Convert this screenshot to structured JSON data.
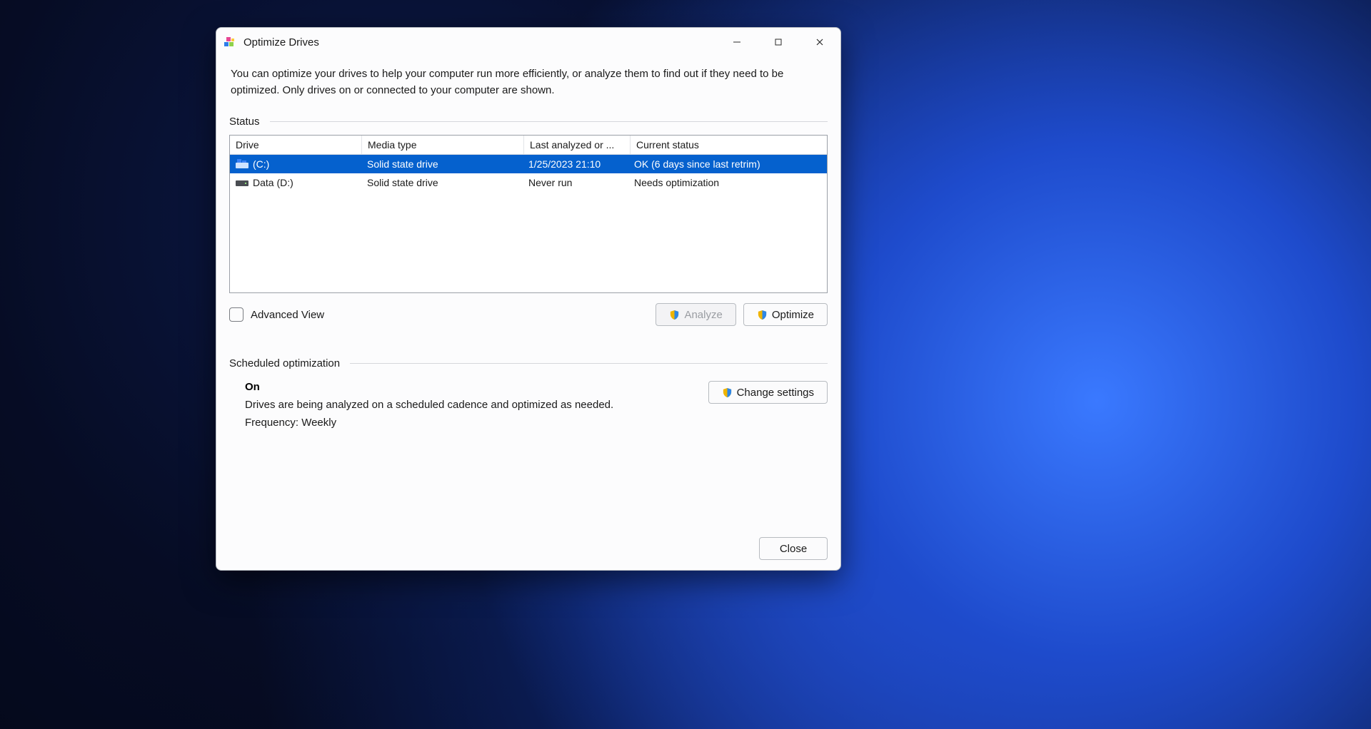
{
  "window": {
    "title": "Optimize Drives"
  },
  "intro": "You can optimize your drives to help your computer run more efficiently, or analyze them to find out if they need to be optimized. Only drives on or connected to your computer are shown.",
  "status_section": {
    "label": "Status",
    "columns": {
      "drive": "Drive",
      "media_type": "Media type",
      "last_analyzed": "Last analyzed or ...",
      "current_status": "Current status"
    },
    "rows": [
      {
        "drive": "(C:)",
        "icon": "os-drive",
        "media_type": "Solid state drive",
        "last_analyzed": "1/25/2023 21:10",
        "current_status": "OK (6 days since last retrim)",
        "selected": true
      },
      {
        "drive": "Data (D:)",
        "icon": "data-drive",
        "media_type": "Solid state drive",
        "last_analyzed": "Never run",
        "current_status": "Needs optimization",
        "selected": false
      }
    ]
  },
  "advanced_view_label": "Advanced View",
  "buttons": {
    "analyze": "Analyze",
    "optimize": "Optimize",
    "change_settings": "Change settings",
    "close": "Close"
  },
  "scheduled": {
    "label": "Scheduled optimization",
    "state": "On",
    "description": "Drives are being analyzed on a scheduled cadence and optimized as needed.",
    "frequency": "Frequency: Weekly"
  }
}
